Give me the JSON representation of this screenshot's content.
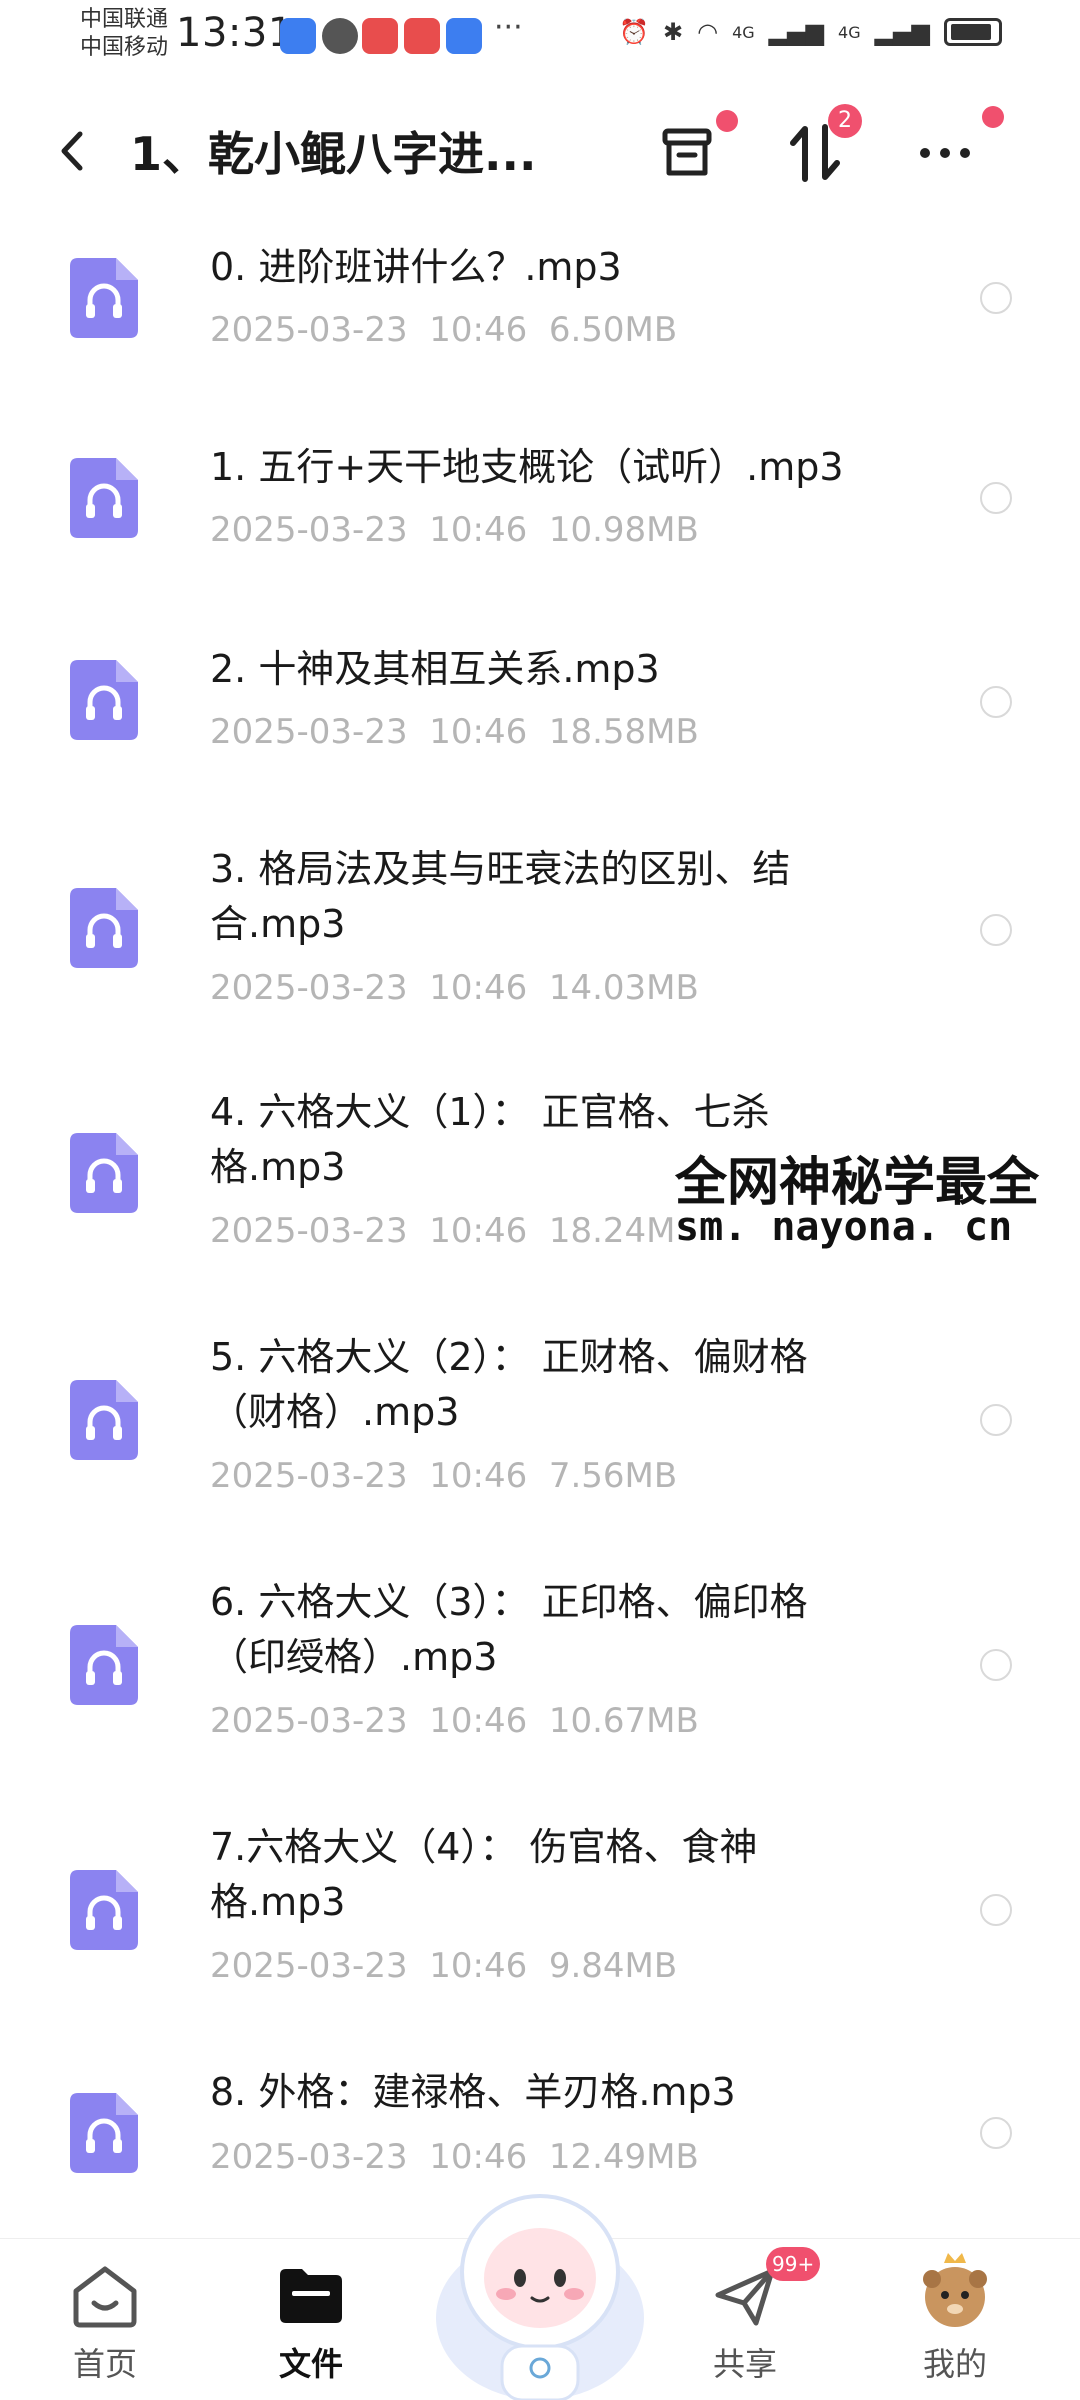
{
  "status_bar": {
    "carrier_1": "中国联通",
    "carrier_2": "中国移动",
    "time": "13:31",
    "more": "···",
    "network_1": "4G",
    "network_2": "4G"
  },
  "header": {
    "title": "1、乾小鲲八字进...",
    "sort_badge": "2"
  },
  "files": [
    {
      "name": "0. 进阶班讲什么？.mp3",
      "date": "2025-03-23",
      "time": "10:46",
      "size": "6.50MB"
    },
    {
      "name": "1. 五行+天干地支概论（试听）.mp3",
      "date": "2025-03-23",
      "time": "10:46",
      "size": "10.98MB"
    },
    {
      "name": "2. 十神及其相互关系.mp3",
      "date": "2025-03-23",
      "time": "10:46",
      "size": "18.58MB"
    },
    {
      "name": "3. 格局法及其与旺衰法的区别、结合.mp3",
      "date": "2025-03-23",
      "time": "10:46",
      "size": "14.03MB"
    },
    {
      "name": "4. 六格大义（1）： 正官格、七杀格.mp3",
      "date": "2025-03-23",
      "time": "10:46",
      "size": "18.24MB"
    },
    {
      "name": "5. 六格大义（2）： 正财格、偏财格（财格）.mp3",
      "date": "2025-03-23",
      "time": "10:46",
      "size": "7.56MB"
    },
    {
      "name": "6. 六格大义（3）： 正印格、偏印格（印绶格）.mp3",
      "date": "2025-03-23",
      "time": "10:46",
      "size": "10.67MB"
    },
    {
      "name": "7.六格大义（4）： 伤官格、食神格.mp3",
      "date": "2025-03-23",
      "time": "10:46",
      "size": "9.84MB"
    },
    {
      "name": "8. 外格：建禄格、羊刃格.mp3",
      "date": "2025-03-23",
      "time": "10:46",
      "size": "12.49MB"
    }
  ],
  "watermark": {
    "line1": "全网神秘学最全",
    "line2": "sm. nayona. cn"
  },
  "nav": {
    "home": "首页",
    "files": "文件",
    "share": "共享",
    "share_badge": "99+",
    "mine": "我的"
  },
  "colors": {
    "file_icon": "#8b83f0",
    "badge": "#f0506e",
    "meta_text": "#b5b5b5"
  }
}
